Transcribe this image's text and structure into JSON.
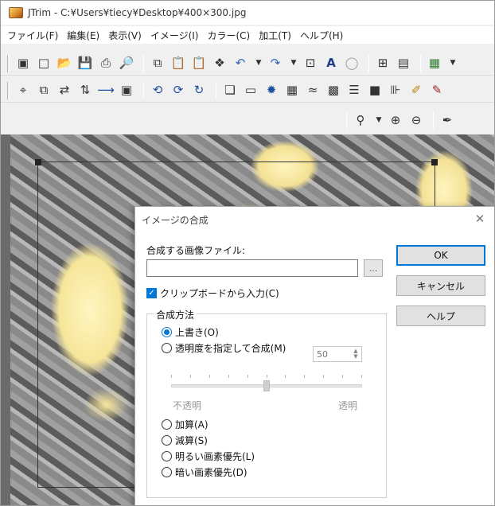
{
  "window": {
    "title": "JTrim - C:¥Users¥tiecy¥Desktop¥400×300.jpg"
  },
  "menu": {
    "items": [
      "ファイル(F)",
      "編集(E)",
      "表示(V)",
      "イメージ(I)",
      "カラー(C)",
      "加工(T)",
      "ヘルプ(H)"
    ]
  },
  "toolbar1_icons": [
    "new-window-icon",
    "new-file-icon",
    "open-folder-icon",
    "save-icon",
    "print-icon",
    "print-preview-icon",
    "copy-icon",
    "paste-icon",
    "paste-new-icon",
    "brush-icon",
    "undo-icon",
    "redo-icon",
    "fit-window-icon",
    "text-icon",
    "stamp-icon",
    "grid-icon",
    "panel-icon",
    "color-icon"
  ],
  "toolbar2_icons": [
    "crop-icon",
    "resize-icon",
    "flip-h-icon",
    "flip-v-icon",
    "merge-icon",
    "frame-icon",
    "rotate-90-left-icon",
    "rotate-90-right-icon",
    "rotate-free-icon",
    "shadow-icon",
    "rect-icon",
    "burst-icon",
    "mosaic-icon",
    "wave-icon",
    "sepia-icon",
    "lines-icon",
    "black-icon",
    "sharpen-icon",
    "pen-icon",
    "eraser-icon"
  ],
  "toolbar3_icons": [
    "zoom-dropdown-icon",
    "zoom-in-icon",
    "zoom-out-icon",
    "eyedropper-icon"
  ],
  "dialog": {
    "title": "イメージの合成",
    "file_label": "合成する画像ファイル:",
    "file_value": "",
    "browse_label": "...",
    "clipboard_label": "クリップボードから入力(C)",
    "clipboard_checked": true,
    "method_group_label": "合成方法",
    "options": [
      {
        "label": "上書き(O)",
        "selected": true
      },
      {
        "label": "透明度を指定して合成(M)",
        "selected": false
      },
      {
        "label": "加算(A)",
        "selected": false
      },
      {
        "label": "減算(S)",
        "selected": false
      },
      {
        "label": "明るい画素優先(L)",
        "selected": false
      },
      {
        "label": "暗い画素優先(D)",
        "selected": false
      }
    ],
    "opacity_value": "50",
    "slider_fraction": 0.5,
    "slider_min_label": "不透明",
    "slider_max_label": "透明",
    "ok_label": "OK",
    "cancel_label": "キャンセル",
    "help_label": "ヘルプ"
  }
}
